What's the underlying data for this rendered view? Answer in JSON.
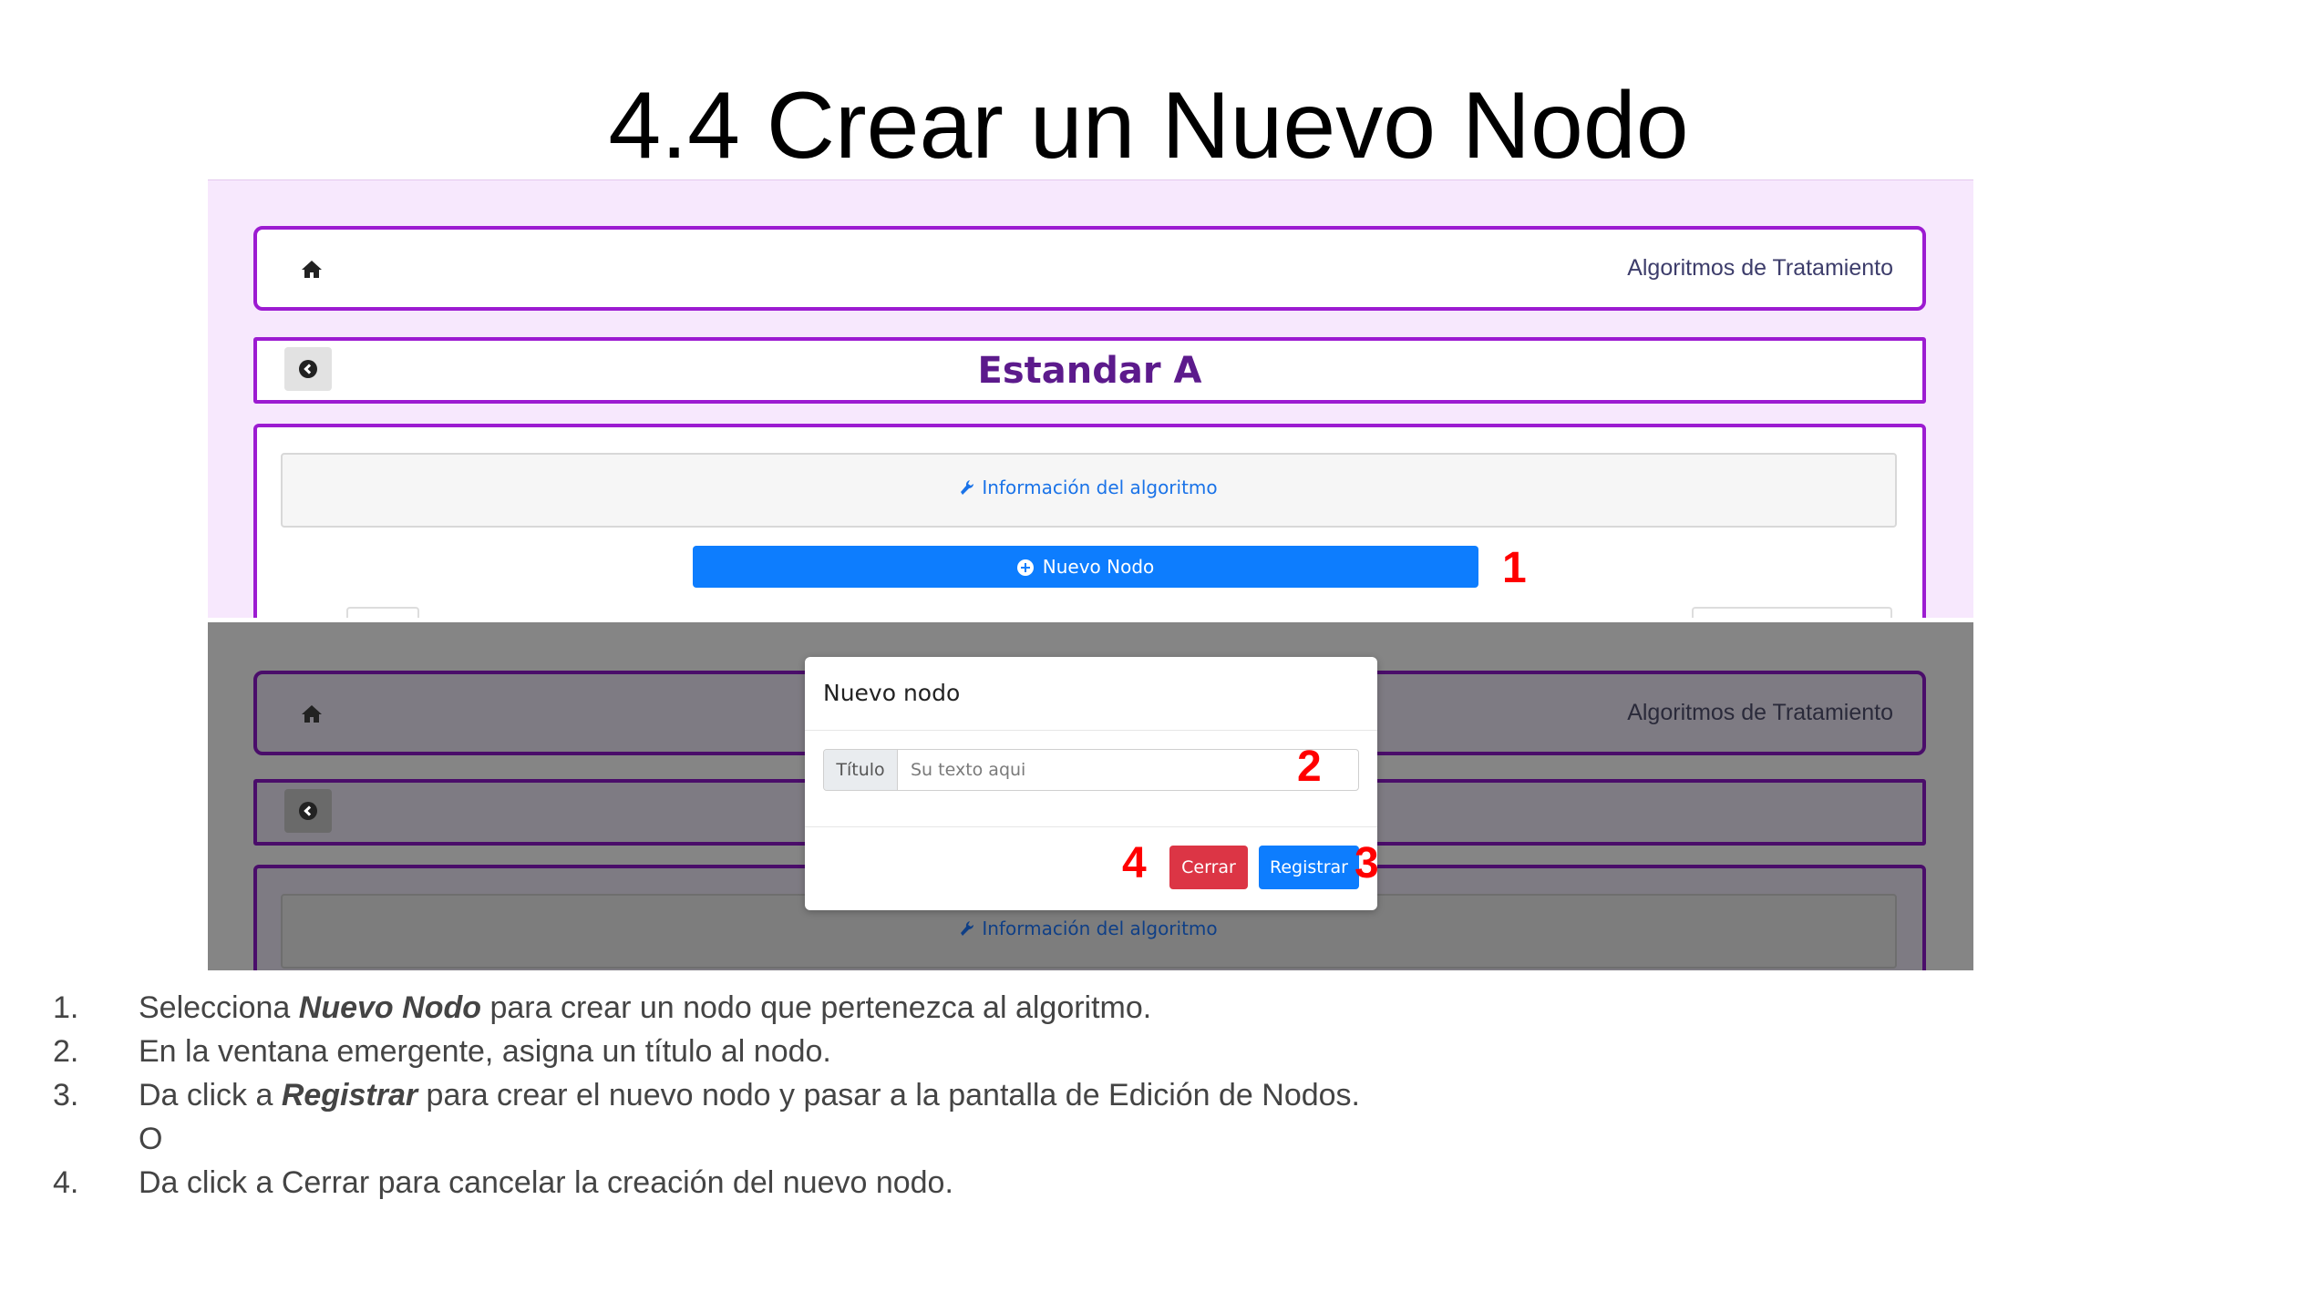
{
  "slide": {
    "title": "4.4 Crear un Nuevo Nodo"
  },
  "app": {
    "nav": {
      "home_icon": "home-icon",
      "link": "Algoritmos de Tratamiento"
    },
    "header": {
      "back_icon": "chevron-circle-left-icon",
      "title": "Estandar A"
    },
    "content": {
      "info_link": "Información del algoritmo",
      "info_icon": "wrench-icon",
      "new_node_button": "Nuevo Nodo",
      "new_node_icon": "plus-circle-icon"
    }
  },
  "modal": {
    "title": "Nuevo nodo",
    "field_label": "Título",
    "field_placeholder": "Su texto aqui",
    "cancel_button": "Cerrar",
    "submit_button": "Registrar"
  },
  "markers": {
    "m1": "1",
    "m2": "2",
    "m3": "3",
    "m4": "4"
  },
  "colors": {
    "accent_purple": "#9c1bd1",
    "primary_blue": "#0d7dfe",
    "danger_red": "#dc3545",
    "marker_red": "#ff0000"
  },
  "steps": [
    {
      "num": "1.",
      "pre": "Selecciona ",
      "em": "Nuevo Nodo",
      "post": " para crear un nodo que pertenezca al algoritmo."
    },
    {
      "num": "2.",
      "pre": "En la ventana emergente, asigna un título al nodo.",
      "em": "",
      "post": ""
    },
    {
      "num": "3.",
      "pre": "Da click a ",
      "em": "Registrar",
      "post": " para crear el nuevo nodo y pasar a la pantalla de Edición de Nodos."
    },
    {
      "num": "",
      "pre": "O",
      "em": "",
      "post": ""
    },
    {
      "num": "4.",
      "pre": "Da click a Cerrar para cancelar la creación del nuevo nodo.",
      "em": "",
      "post": ""
    }
  ]
}
